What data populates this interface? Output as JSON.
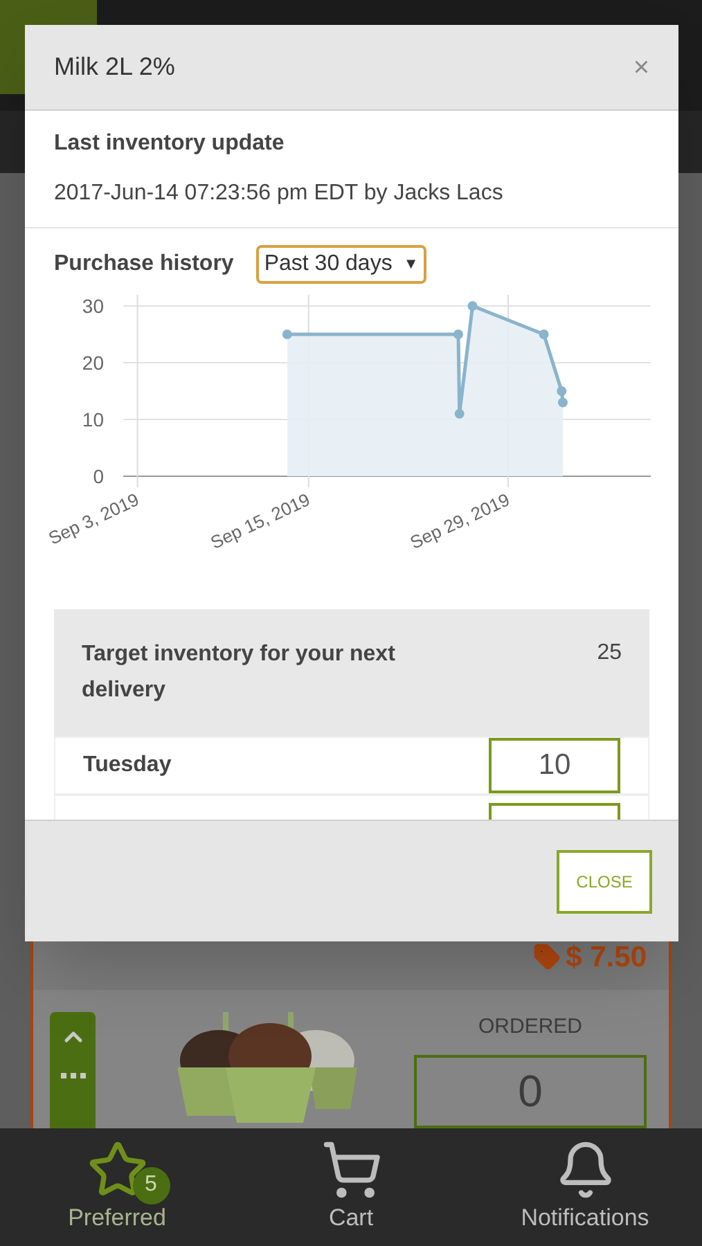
{
  "background": {
    "price": "$ 7.50",
    "ordered_label": "ORDERED",
    "ordered_value": "0"
  },
  "modal": {
    "title": "Milk 2L 2%",
    "close_icon": "×",
    "last_update": {
      "label": "Last inventory update",
      "value": "2017-Jun-14 07:23:56 pm EDT by Jacks Lacs"
    },
    "purchase_history": {
      "label": "Purchase history",
      "range": "Past 30 days",
      "caret": "▼",
      "chart_data": {
        "type": "area",
        "grid": true,
        "xlim": [
          "2019-09-02",
          "2019-10-09"
        ],
        "ylim": [
          0,
          30
        ],
        "yticks": [
          0,
          10,
          20,
          30
        ],
        "xticks": [
          {
            "value": "2019-09-03",
            "label": "Sep 3, 2019"
          },
          {
            "value": "2019-09-15",
            "label": "Sep 15, 2019"
          },
          {
            "value": "2019-09-29",
            "label": "Sep 29, 2019"
          }
        ],
        "x": [
          "2019-09-13T12:00",
          "2019-09-25T12:00",
          "2019-09-25T14:00",
          "2019-09-26T12:00",
          "2019-10-01T12:00",
          "2019-10-02T18:00",
          "2019-10-02T20:00"
        ],
        "series": [
          {
            "color": "#8ab4cc",
            "values": [
              25,
              25,
              11,
              30,
              25,
              15,
              13
            ]
          }
        ]
      }
    },
    "target": {
      "label": "Target inventory for your next delivery",
      "value": "25",
      "rows": [
        {
          "day": "Tuesday",
          "value": "10"
        }
      ]
    },
    "close_button": "CLOSE"
  },
  "nav": [
    {
      "kind": "star",
      "label": "Preferred",
      "badge": "5",
      "selected": true
    },
    {
      "kind": "cart",
      "label": "Cart",
      "selected": false
    },
    {
      "kind": "bell",
      "label": "Notifications",
      "selected": false
    }
  ]
}
